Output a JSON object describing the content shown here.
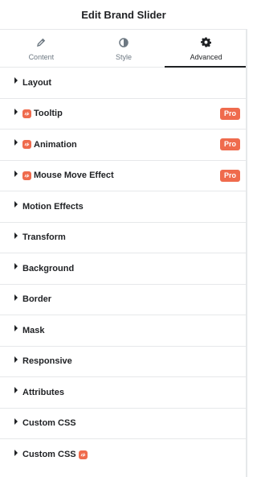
{
  "panel": {
    "title": "Edit Brand Slider"
  },
  "tabs": [
    {
      "label": "Content",
      "icon": "pencil-icon"
    },
    {
      "label": "Style",
      "icon": "half-circle-icon"
    },
    {
      "label": "Advanced",
      "icon": "gear-icon",
      "active": true
    }
  ],
  "sections": [
    {
      "label": "Layout"
    },
    {
      "label": "Tooltip",
      "brand_icon": "before",
      "badge": "Pro"
    },
    {
      "label": "Animation",
      "brand_icon": "before",
      "badge": "Pro"
    },
    {
      "label": "Mouse Move Effect",
      "brand_icon": "before",
      "badge": "Pro"
    },
    {
      "label": "Motion Effects"
    },
    {
      "label": "Transform"
    },
    {
      "label": "Background"
    },
    {
      "label": "Border"
    },
    {
      "label": "Mask"
    },
    {
      "label": "Responsive"
    },
    {
      "label": "Attributes"
    },
    {
      "label": "Custom CSS"
    },
    {
      "label": "Custom CSS",
      "brand_icon": "after"
    }
  ],
  "colors": {
    "accent": "#ef6b4d",
    "text": "#1f2124",
    "muted": "#6d7882",
    "divider": "#e6e8ea"
  }
}
